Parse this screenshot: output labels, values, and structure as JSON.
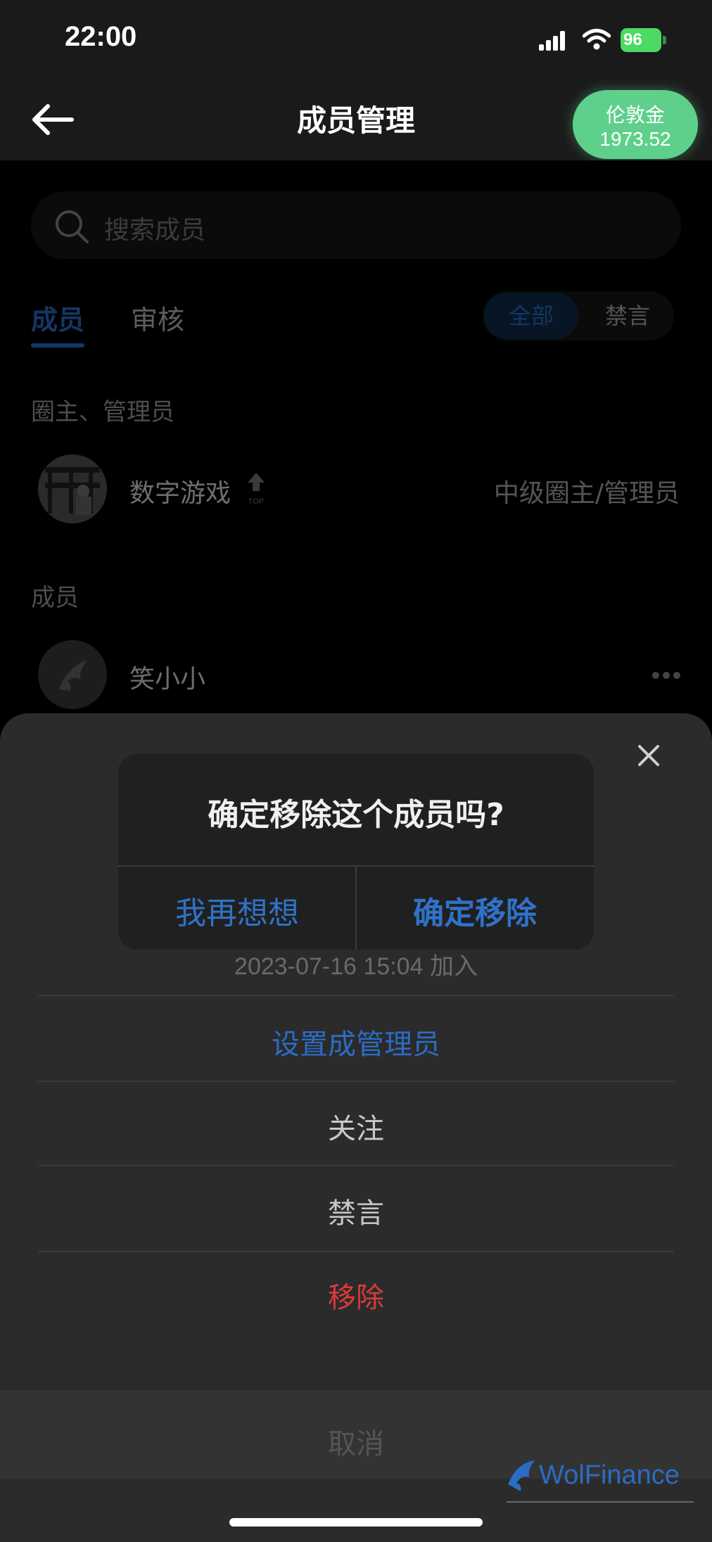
{
  "status_bar": {
    "time": "22:00",
    "battery": "96"
  },
  "nav": {
    "title": "成员管理",
    "coin_label": "伦敦金",
    "coin_value": "1973.52"
  },
  "search": {
    "placeholder": "搜索成员"
  },
  "tabs": {
    "members": "成员",
    "review": "审核"
  },
  "filters": {
    "all": "全部",
    "muted": "禁言"
  },
  "sections": {
    "admins": "圈主、管理员",
    "members": "成员"
  },
  "admin_member": {
    "name": "数字游戏",
    "badge": "TOP",
    "role": "中级圈主/管理员"
  },
  "member": {
    "name": "笑小小"
  },
  "sheet": {
    "join_time": "2023-07-16 15:04 加入",
    "actions": {
      "set_admin": "设置成管理员",
      "follow": "关注",
      "mute": "禁言",
      "remove": "移除"
    },
    "cancel": "取消"
  },
  "dialog": {
    "title": "确定移除这个成员吗?",
    "cancel": "我再想想",
    "confirm": "确定移除"
  },
  "watermark": "WolFinance",
  "colors": {
    "accent": "#2b6cc4",
    "danger": "#d83b3b",
    "coin": "#5fcf8c",
    "battery": "#4cd964"
  }
}
